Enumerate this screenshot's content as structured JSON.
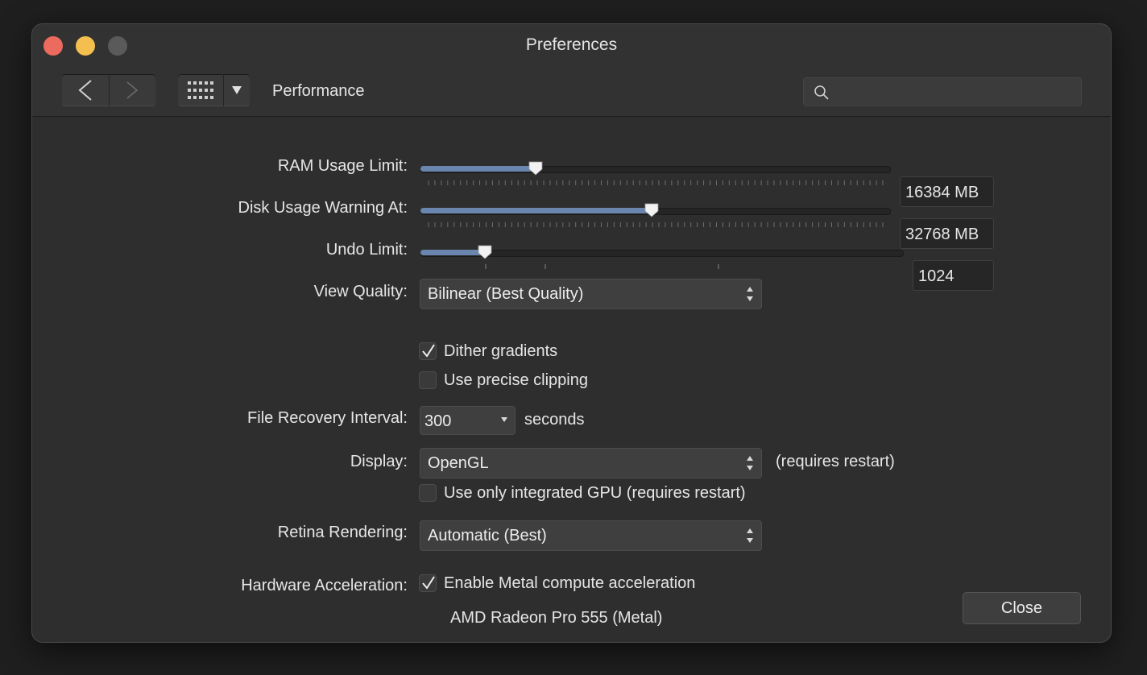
{
  "window": {
    "title": "Preferences"
  },
  "toolbar": {
    "section": "Performance",
    "search_placeholder": ""
  },
  "ram": {
    "label": "RAM Usage Limit:",
    "value": "16384 MB",
    "fraction": 0.245
  },
  "disk": {
    "label": "Disk Usage Warning At:",
    "value": "32768 MB",
    "fraction": 0.492
  },
  "undo": {
    "label": "Undo Limit:",
    "value": "1024",
    "fraction": 0.134
  },
  "view_quality": {
    "label": "View Quality:",
    "selected": "Bilinear (Best Quality)",
    "dither": {
      "label": "Dither gradients",
      "checked": true
    },
    "precise": {
      "label": "Use precise clipping",
      "checked": false
    }
  },
  "recovery": {
    "label": "File Recovery Interval:",
    "value": "300",
    "unit": "seconds"
  },
  "display": {
    "label": "Display:",
    "selected": "OpenGL",
    "note": "(requires restart)",
    "integrated": {
      "label": "Use only integrated GPU (requires restart)",
      "checked": false
    }
  },
  "retina": {
    "label": "Retina Rendering:",
    "selected": "Automatic (Best)"
  },
  "hardware": {
    "label": "Hardware Acceleration:",
    "metal": {
      "label": "Enable Metal compute acceleration",
      "checked": true
    },
    "gpu": "AMD Radeon Pro 555 (Metal)"
  },
  "close_label": "Close",
  "colors": {
    "accent": "#6a86ae",
    "window_bg": "#2e2e2e",
    "red": "#ed6a5e",
    "yellow": "#f5bf4f"
  }
}
